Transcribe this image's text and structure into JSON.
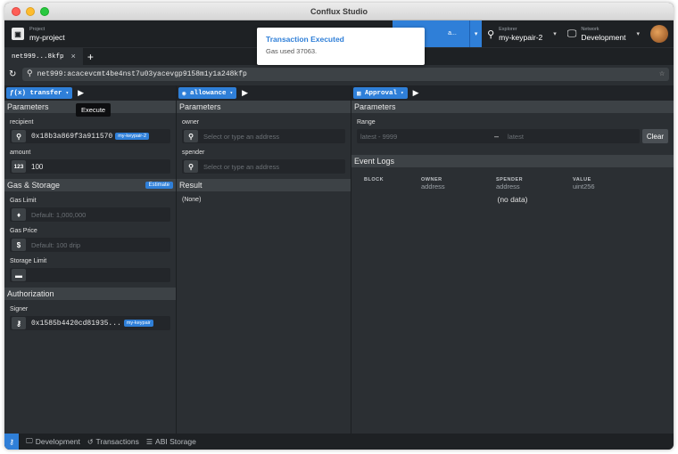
{
  "window": {
    "title": "Conflux Studio"
  },
  "header": {
    "project_label": "Project",
    "project_name": "my-project",
    "blue_fragment": "a...",
    "explorer_label": "Explorer",
    "explorer_value": "my-keypair-2",
    "network_label": "Network",
    "network_value": "Development"
  },
  "toast": {
    "title": "Transaction Executed",
    "message": "Gas used 37063."
  },
  "tabs": [
    {
      "label": "net999...8kfp"
    }
  ],
  "address_bar": {
    "value": "net999:acacevcmt4be4nst7u03yacevgp9158m1y1a248kfp"
  },
  "column1": {
    "function_name": "transfer",
    "tooltip": "Execute",
    "parameters_title": "Parameters",
    "recipient_label": "recipient",
    "recipient_value": "0x18b3a869f3a911570",
    "recipient_badge": "my-keypair-2",
    "amount_label": "amount",
    "amount_icon": "123",
    "amount_value": "100",
    "gas_storage_title": "Gas & Storage",
    "estimate_label": "Estimate",
    "gas_limit_label": "Gas Limit",
    "gas_limit_placeholder": "Default: 1,000,000",
    "gas_price_label": "Gas Price",
    "gas_price_placeholder": "Default: 100 drip",
    "storage_limit_label": "Storage Limit",
    "authorization_title": "Authorization",
    "signer_label": "Signer",
    "signer_value": "0x1585b4420cd81935...",
    "signer_badge": "my-keypair"
  },
  "column2": {
    "function_name": "allowance",
    "parameters_title": "Parameters",
    "owner_label": "owner",
    "owner_placeholder": "Select or type an address",
    "spender_label": "spender",
    "spender_placeholder": "Select or type an address",
    "result_title": "Result",
    "result_value": "(None)"
  },
  "column3": {
    "event_name": "Approval",
    "parameters_title": "Parameters",
    "range_label": "Range",
    "range_from_placeholder": "latest - 9999",
    "range_to_placeholder": "latest",
    "clear_label": "Clear",
    "event_logs_title": "Event Logs",
    "headers": [
      {
        "name": "BLOCK",
        "type": ""
      },
      {
        "name": "OWNER",
        "type": "address"
      },
      {
        "name": "SPENDER",
        "type": "address"
      },
      {
        "name": "VALUE",
        "type": "uint256"
      }
    ],
    "no_data": "(no data)"
  },
  "statusbar": {
    "development": "Development",
    "transactions": "Transactions",
    "abi_storage": "ABI Storage"
  },
  "colors": {
    "accent": "#2f7fd8",
    "panel": "#2b2f33",
    "header": "#1e2124"
  }
}
